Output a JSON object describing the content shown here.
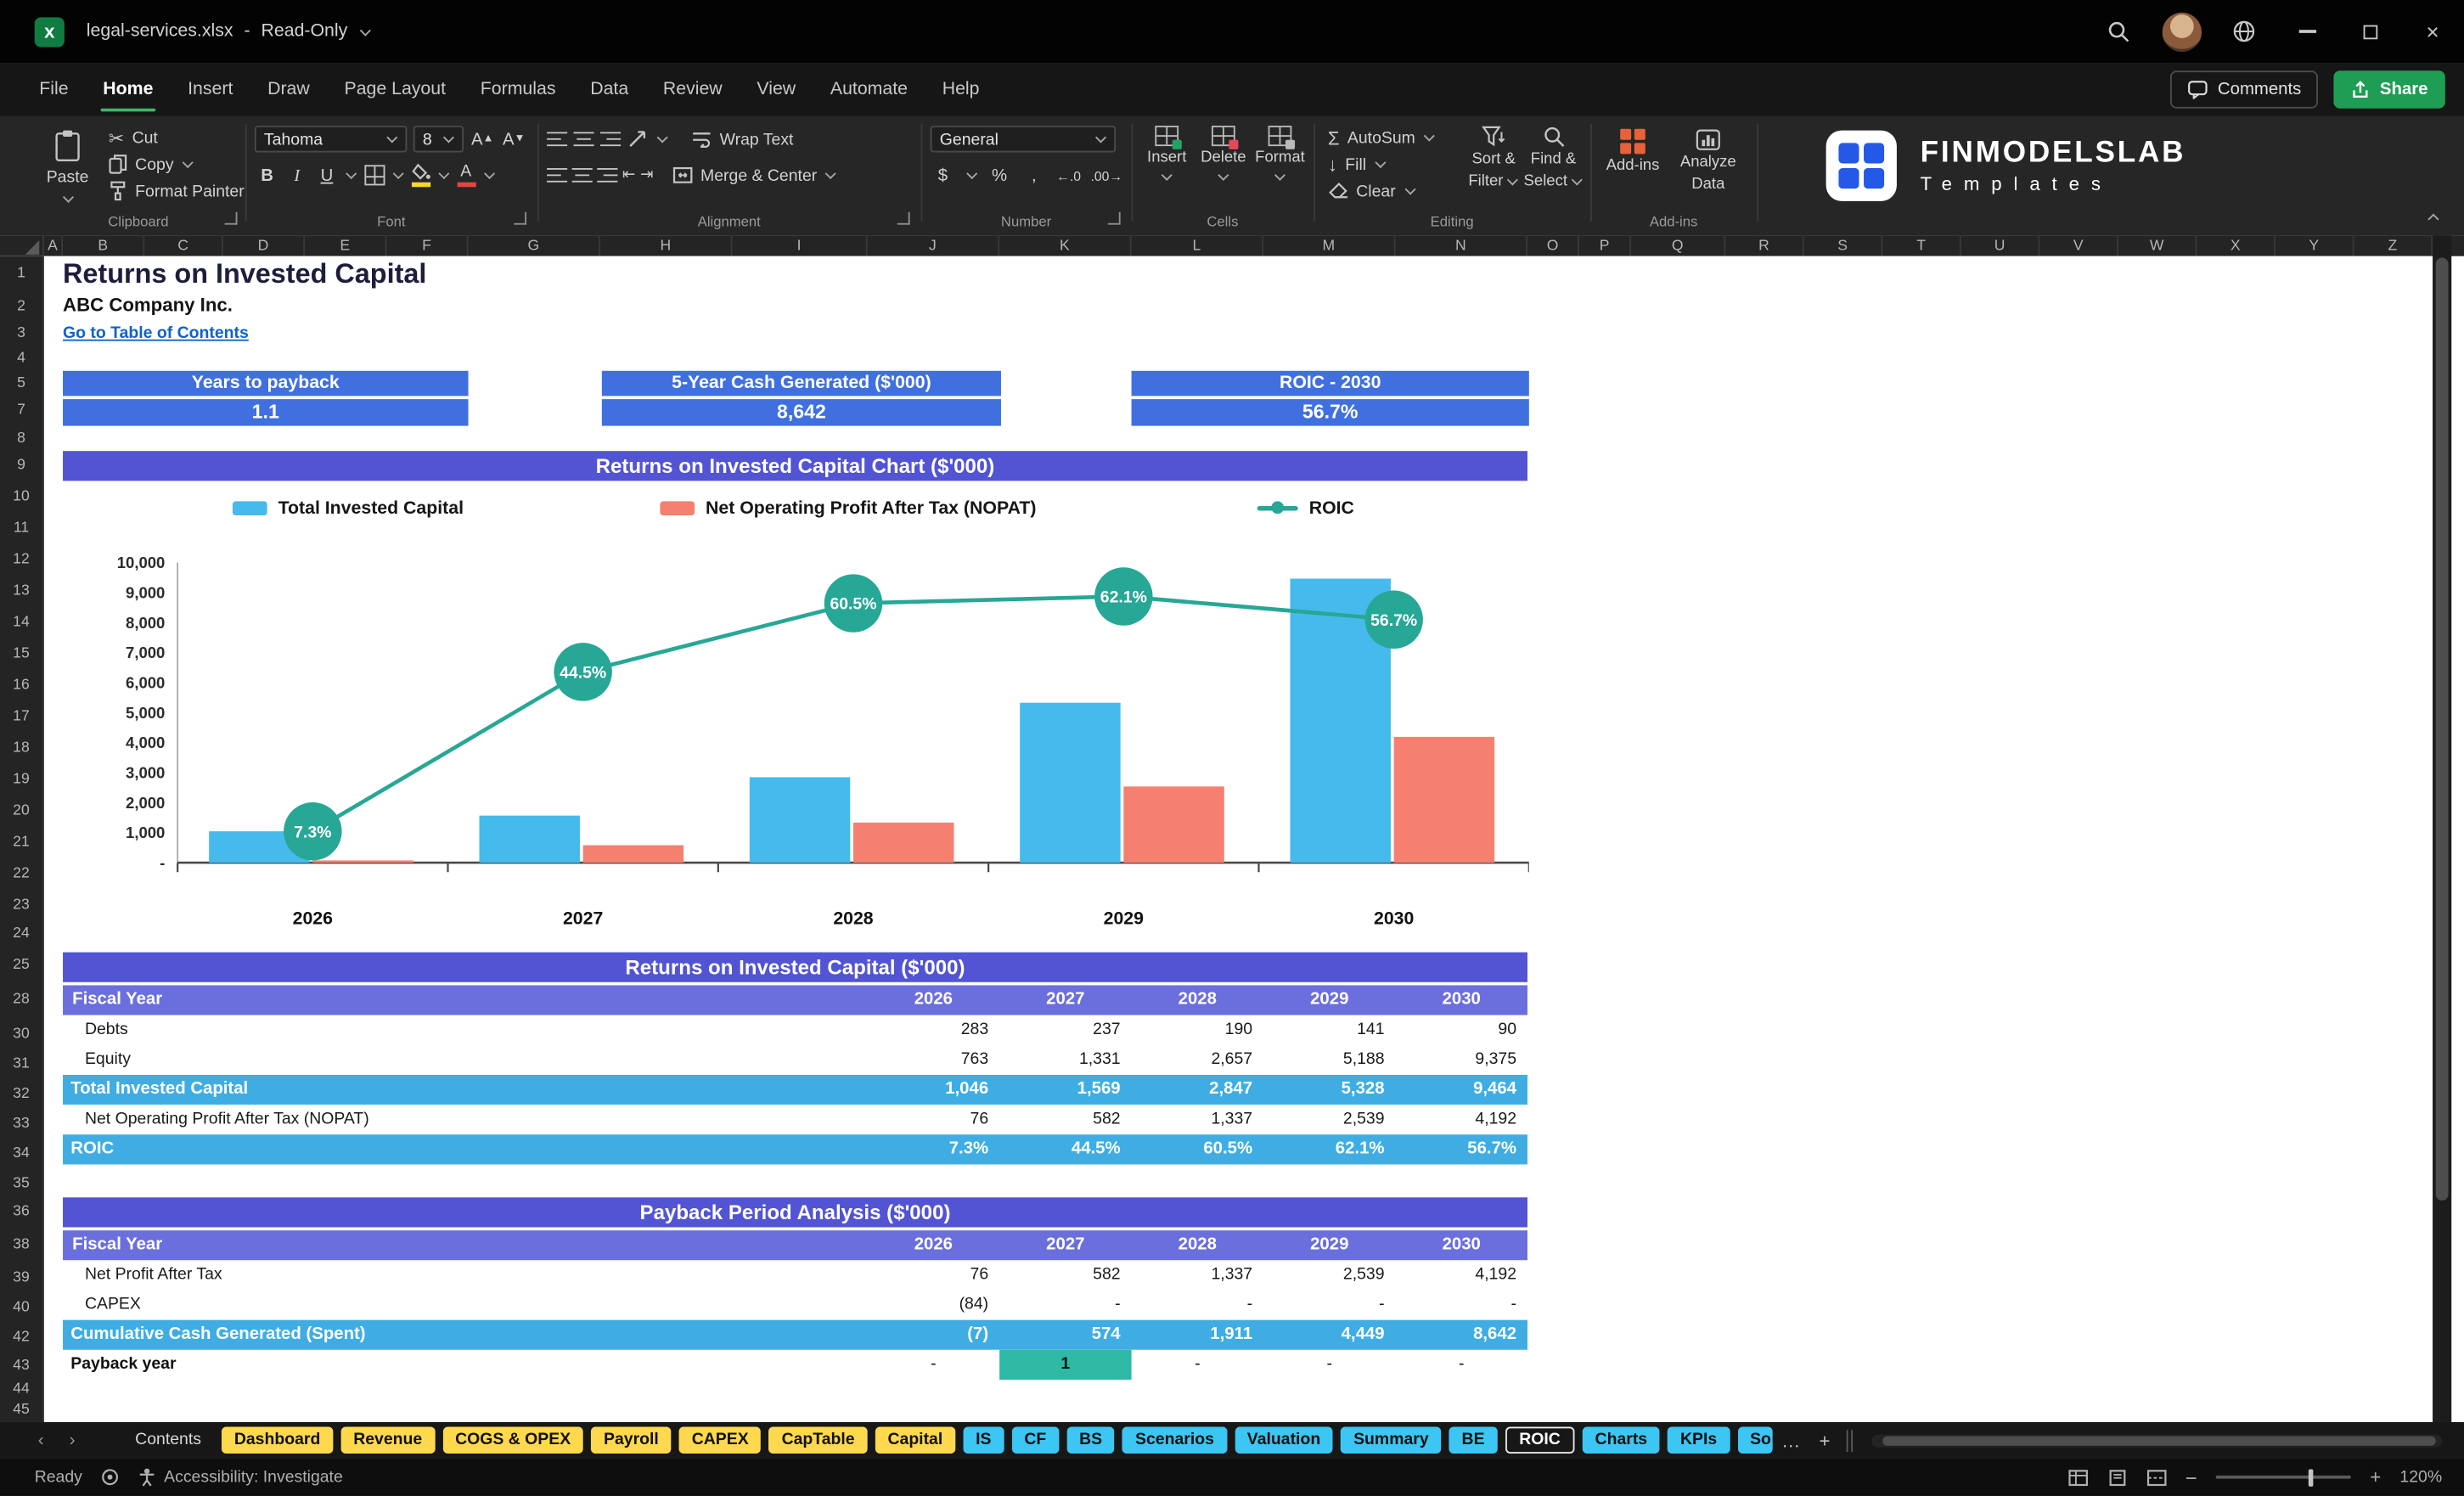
{
  "colors": {
    "accent-blue": "#4070DF",
    "section-purple": "#5254D4",
    "fiscal-purple": "#6B6FDD",
    "highlight-cyan": "#3FADE4",
    "teal": "#27A795",
    "payback-teal": "#2EB9A4",
    "bar-blue": "#45BAED",
    "bar-red": "#F5806F",
    "link-blue": "#0E63C8",
    "tab-yellow": "#FFD94D",
    "tab-blue": "#3BC6F3",
    "share-green": "#1E9E54",
    "excel-green": "#107C41",
    "title-navy": "#1D1D3C",
    "menu-underline": "#3FB768"
  },
  "title_bar": {
    "filename": "legal-services.xlsx",
    "separator": "-",
    "mode": "Read-Only"
  },
  "menu": {
    "items": [
      "File",
      "Home",
      "Insert",
      "Draw",
      "Page Layout",
      "Formulas",
      "Data",
      "Review",
      "View",
      "Automate",
      "Help"
    ],
    "active": "Home",
    "comments_label": "Comments",
    "share_label": "Share"
  },
  "ribbon": {
    "clipboard": {
      "label": "Clipboard",
      "paste": "Paste",
      "cut": "Cut",
      "copy": "Copy",
      "format_painter": "Format Painter"
    },
    "font": {
      "label": "Font",
      "family": "Tahoma",
      "size": "8"
    },
    "alignment": {
      "label": "Alignment",
      "wrap": "Wrap Text",
      "merge": "Merge & Center"
    },
    "number": {
      "label": "Number",
      "format": "General"
    },
    "cells": {
      "label": "Cells",
      "insert": "Insert",
      "delete": "Delete",
      "format": "Format"
    },
    "editing": {
      "label": "Editing",
      "autosum": "AutoSum",
      "fill": "Fill",
      "clear": "Clear",
      "sort_line1": "Sort &",
      "sort_line2": "Filter",
      "find_line1": "Find &",
      "find_line2": "Select"
    },
    "addins": {
      "label": "Add-ins",
      "addins": "Add-ins",
      "analyze_line1": "Analyze",
      "analyze_line2": "Data"
    },
    "brand": {
      "name": "FINMODELSLAB",
      "tagline": "Templates"
    }
  },
  "grid": {
    "columns": [
      "A",
      "B",
      "C",
      "D",
      "E",
      "F",
      "G",
      "H",
      "I",
      "J",
      "K",
      "L",
      "M",
      "N",
      "O",
      "P",
      "Q",
      "R",
      "S",
      "T",
      "U",
      "V",
      "W",
      "X",
      "Y",
      "Z"
    ],
    "rows": [
      "1",
      "2",
      "3",
      "4",
      "5",
      "7",
      "8",
      "9",
      "10",
      "11",
      "12",
      "13",
      "14",
      "15",
      "16",
      "17",
      "18",
      "19",
      "20",
      "21",
      "22",
      "23",
      "24",
      "25",
      "28",
      "30",
      "31",
      "32",
      "33",
      "34",
      "35",
      "36",
      "38",
      "39",
      "40",
      "42",
      "43",
      "44",
      "45"
    ]
  },
  "sheet": {
    "title": "Returns on Invested Capital",
    "company": "ABC Company Inc.",
    "link": "Go to Table of Contents",
    "kpis": [
      {
        "label": "Years to payback",
        "value": "1.1"
      },
      {
        "label": "5-Year Cash Generated ($'000)",
        "value": "8,642"
      },
      {
        "label": "ROIC - 2030",
        "value": "56.7%"
      }
    ],
    "roic_table": {
      "title": "Returns on Invested Capital ($'000)",
      "header": {
        "label": "Fiscal Year",
        "years": [
          "2026",
          "2027",
          "2028",
          "2029",
          "2030"
        ]
      },
      "rows": [
        {
          "label": "Debts",
          "style": "plain",
          "values": [
            "283",
            "237",
            "190",
            "141",
            "90"
          ]
        },
        {
          "label": "Equity",
          "style": "plain",
          "values": [
            "763",
            "1,331",
            "2,657",
            "5,188",
            "9,375"
          ]
        },
        {
          "label": "Total Invested Capital",
          "style": "highlight",
          "values": [
            "1,046",
            "1,569",
            "2,847",
            "5,328",
            "9,464"
          ]
        },
        {
          "label": "Net Operating Profit After Tax (NOPAT)",
          "style": "plain",
          "values": [
            "76",
            "582",
            "1,337",
            "2,539",
            "4,192"
          ]
        },
        {
          "label": "ROIC",
          "style": "highlight",
          "values": [
            "7.3%",
            "44.5%",
            "60.5%",
            "62.1%",
            "56.7%"
          ]
        }
      ]
    },
    "payback_table": {
      "title": "Payback Period Analysis ($'000)",
      "header": {
        "label": "Fiscal Year",
        "years": [
          "2026",
          "2027",
          "2028",
          "2029",
          "2030"
        ]
      },
      "rows": [
        {
          "label": "Net Profit After Tax",
          "style": "plain",
          "values": [
            "76",
            "582",
            "1,337",
            "2,539",
            "4,192"
          ]
        },
        {
          "label": "CAPEX",
          "style": "plain",
          "values": [
            "(84)",
            "-",
            "-",
            "-",
            "-"
          ]
        },
        {
          "label": "Cumulative Cash Generated (Spent)",
          "style": "highlight",
          "values": [
            "(7)",
            "574",
            "1,911",
            "4,449",
            "8,642"
          ]
        },
        {
          "label": "Payback year",
          "style": "payback",
          "values": [
            "-",
            "1",
            "-",
            "-",
            "-"
          ],
          "highlight_cell": 1
        }
      ]
    }
  },
  "chart_data": {
    "type": "bar+line",
    "title": "Returns on Invested Capital Chart ($'000)",
    "categories": [
      "2026",
      "2027",
      "2028",
      "2029",
      "2030"
    ],
    "series": [
      {
        "name": "Total Invested Capital",
        "type": "bar",
        "color": "#45BAED",
        "values": [
          1046,
          1569,
          2847,
          5328,
          9464
        ]
      },
      {
        "name": "Net Operating Profit After Tax (NOPAT)",
        "type": "bar",
        "color": "#F5806F",
        "values": [
          76,
          582,
          1337,
          2539,
          4192
        ]
      },
      {
        "name": "ROIC",
        "type": "line",
        "color": "#27A795",
        "values": [
          7.3,
          44.5,
          60.5,
          62.1,
          56.7
        ],
        "labels": [
          "7.3%",
          "44.5%",
          "60.5%",
          "62.1%",
          "56.7%"
        ]
      }
    ],
    "y_axis": {
      "min": 0,
      "max": 10000,
      "step": 1000,
      "tick_labels": [
        "-",
        "1,000",
        "2,000",
        "3,000",
        "4,000",
        "5,000",
        "6,000",
        "7,000",
        "8,000",
        "9,000",
        "10,000"
      ]
    },
    "secondary_axis": {
      "min": 0,
      "max": 70
    },
    "grid": "off",
    "legend_position": "top"
  },
  "sheet_tabs": [
    {
      "label": "Contents",
      "style": "none"
    },
    {
      "label": "Dashboard",
      "style": "yellow"
    },
    {
      "label": "Revenue",
      "style": "yellow"
    },
    {
      "label": "COGS & OPEX",
      "style": "yellow"
    },
    {
      "label": "Payroll",
      "style": "yellow"
    },
    {
      "label": "CAPEX",
      "style": "yellow"
    },
    {
      "label": "CapTable",
      "style": "yellow"
    },
    {
      "label": "Capital",
      "style": "yellow"
    },
    {
      "label": "IS",
      "style": "blue"
    },
    {
      "label": "CF",
      "style": "blue"
    },
    {
      "label": "BS",
      "style": "blue"
    },
    {
      "label": "Scenarios",
      "style": "blue"
    },
    {
      "label": "Valuation",
      "style": "blue"
    },
    {
      "label": "Summary",
      "style": "blue"
    },
    {
      "label": "BE",
      "style": "blue"
    },
    {
      "label": "ROIC",
      "style": "active"
    },
    {
      "label": "Charts",
      "style": "blue"
    },
    {
      "label": "KPIs",
      "style": "blue"
    },
    {
      "label": "So",
      "style": "blue trunc"
    }
  ],
  "status_bar": {
    "ready": "Ready",
    "accessibility": "Accessibility: Investigate",
    "zoom": "120%"
  }
}
